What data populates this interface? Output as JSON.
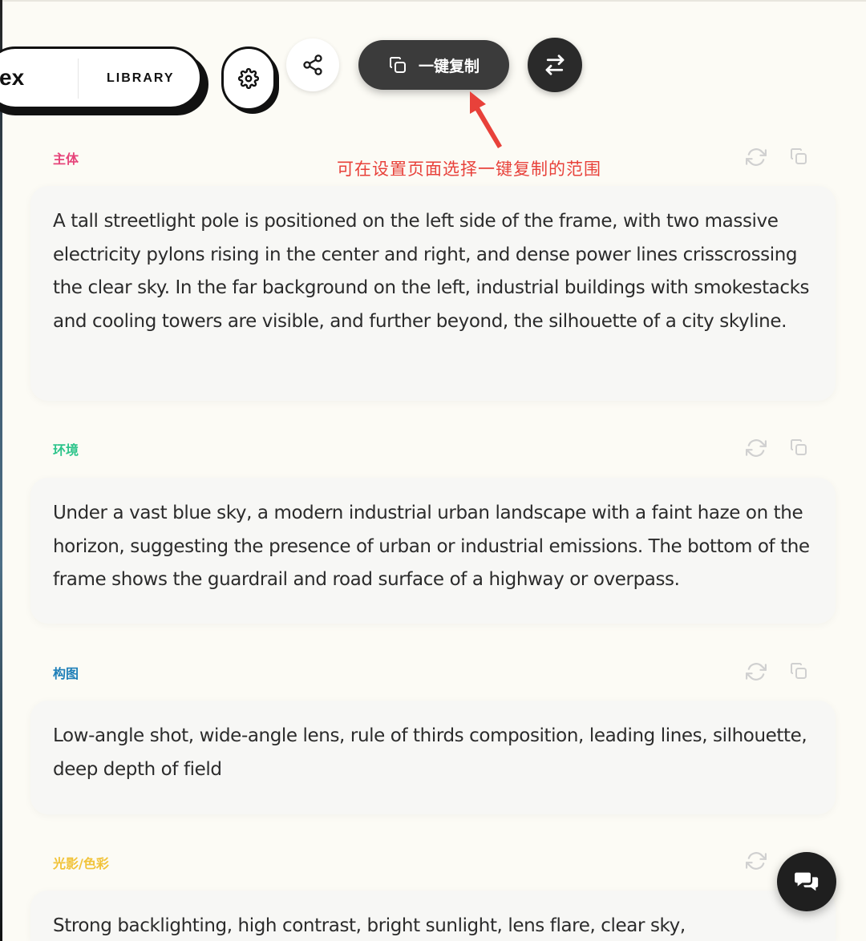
{
  "toolbar": {
    "brand": "ex",
    "library_label": "LIBRARY",
    "copy_all_label": "一键复制"
  },
  "annotation": "可在设置页面选择一键复制的范围",
  "colors": {
    "subject": "#e6447a",
    "environment": "#2bc48a",
    "composition": "#1e7fb8",
    "lighting": "#f1c33a",
    "annotation": "#e8413a",
    "background": "#fcfbf5"
  },
  "sections": [
    {
      "label": "主体",
      "text": "A tall streetlight pole is positioned on the left side of the frame, with two massive electricity pylons rising in the center and right, and dense power lines crisscrossing the clear sky. In the far background on the left, industrial buildings with smokestacks and cooling towers are visible, and further beyond, the silhouette of a city skyline."
    },
    {
      "label": "环境",
      "text": "Under a vast blue sky, a modern industrial urban landscape with a faint haze on the horizon, suggesting the presence of urban or industrial emissions. The bottom of the frame shows the guardrail and road surface of a highway or overpass."
    },
    {
      "label": "构图",
      "text": "Low-angle shot, wide-angle lens, rule of thirds composition, leading lines, silhouette, deep depth of field"
    },
    {
      "label": "光影/色彩",
      "text": "Strong backlighting, high contrast, bright sunlight, lens flare, clear sky,"
    }
  ],
  "icons": [
    "settings-gear-icon",
    "share-icon",
    "copy-icon",
    "swap-icon",
    "refresh-icon",
    "chat-icon"
  ]
}
